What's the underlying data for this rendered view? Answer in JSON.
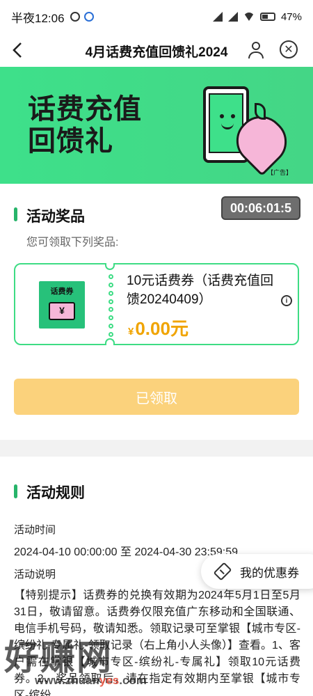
{
  "status_bar": {
    "time": "半夜12:06",
    "battery": "47%",
    "icons": [
      "clock-icon",
      "app-icon",
      "signal-icon",
      "signal-icon",
      "wifi-icon",
      "battery-icon"
    ]
  },
  "nav": {
    "title": "4月话费充值回馈礼2024",
    "back_icon": "chevron-left-icon",
    "user_icon": "user-icon",
    "close_icon": "close-icon",
    "close_glyph": "✕"
  },
  "banner": {
    "line1": "话费充值",
    "line2": "回馈礼",
    "ad_label": "【广告】"
  },
  "prize_section": {
    "title": "活动奖品",
    "countdown": "00:06:01:5",
    "subtitle": "您可领取下列奖品:",
    "coupon": {
      "image_label": "话费券",
      "name": "10元话费券（话费充值回馈20240409）",
      "currency": "¥",
      "price": "0.00元",
      "info_glyph": "i"
    },
    "claim_button": "已领取"
  },
  "rules_section": {
    "title": "活动规则",
    "time_label": "活动时间",
    "time_value": "2024-04-10 00:00:00 至 2024-04-30 23:59:59",
    "desc_label": "活动说明",
    "desc_text": "【特别提示】话费券的兑换有效期为2024年5月1日至5月31日，敬请留意。话费券仅限充值广东移动和全国联通、电信手机号码，敬请知悉。领取记录可至掌银【城市专区-缤纷礼-专属礼-领取记录（右上角小人头像）】查看。1、客户需在掌银【城市专区-缤纷礼-专属礼】领取10元话费券。2、奖品领取后，请在指定有效期内至掌银【城市专区-缤纷"
  },
  "floating": {
    "my_coupons": "我的优惠券"
  },
  "watermark": {
    "text": "好赚网",
    "url_prefix": "www.zhuan",
    "url_highlight": "yes",
    "url_suffix": ".com"
  },
  "colors": {
    "brand_green": "#3ddc84",
    "price_orange": "#f0a400",
    "claimed_button": "#fbd27c"
  }
}
